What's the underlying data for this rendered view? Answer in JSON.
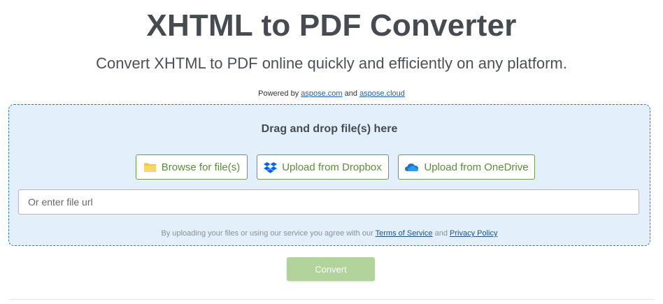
{
  "header": {
    "title": "XHTML to PDF Converter",
    "subtitle": "Convert XHTML to PDF online quickly and efficiently on any platform.",
    "powered_prefix": "Powered by",
    "powered_link1": "aspose.com",
    "powered_and": "and",
    "powered_link2": "aspose.cloud"
  },
  "dropzone": {
    "title": "Drag and drop file(s) here",
    "buttons": {
      "browse": {
        "label": "Browse for file(s)",
        "icon": "folder-icon"
      },
      "dropbox": {
        "label": "Upload from Dropbox",
        "icon": "dropbox-icon"
      },
      "onedrive": {
        "label": "Upload from OneDrive",
        "icon": "onedrive-icon"
      }
    },
    "url_input": {
      "placeholder": "Or enter file url",
      "value": ""
    },
    "terms": {
      "prefix": "By uploading your files or using our service you agree with our",
      "tos_link": "Terms of Service",
      "and": "and",
      "privacy_link": "Privacy Policy"
    }
  },
  "actions": {
    "convert_label": "Convert"
  },
  "colors": {
    "dropzone_bg": "#e3f0fb",
    "dropzone_border": "#2a7bb0",
    "button_text": "#5a8f3a",
    "convert_disabled": "#b3d39c",
    "dropbox_blue": "#0061fe",
    "folder_yellow": "#f5c542"
  }
}
